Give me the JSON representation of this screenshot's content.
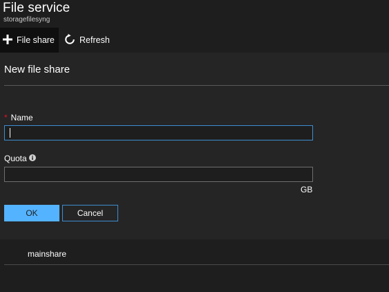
{
  "header": {
    "title": "File service",
    "subtitle": "storagefilesyng"
  },
  "toolbar": {
    "file_share": {
      "label": "File share",
      "icon": "plus-icon"
    },
    "refresh": {
      "label": "Refresh",
      "icon": "refresh-icon"
    }
  },
  "dialog": {
    "title": "New file share",
    "name": {
      "label": "Name",
      "required_mark": "*",
      "value": "",
      "placeholder": ""
    },
    "quota": {
      "label": "Quota",
      "info_icon": "info-icon",
      "value": "",
      "placeholder": "",
      "unit": "GB"
    },
    "ok_label": "OK",
    "cancel_label": "Cancel"
  },
  "list": {
    "items": [
      {
        "label": "mainshare"
      }
    ]
  },
  "colors": {
    "background": "#1e1e1e",
    "panel": "#252526",
    "accent": "#54b3ff",
    "focus_border": "#3e8ed0",
    "required": "#e81123"
  }
}
